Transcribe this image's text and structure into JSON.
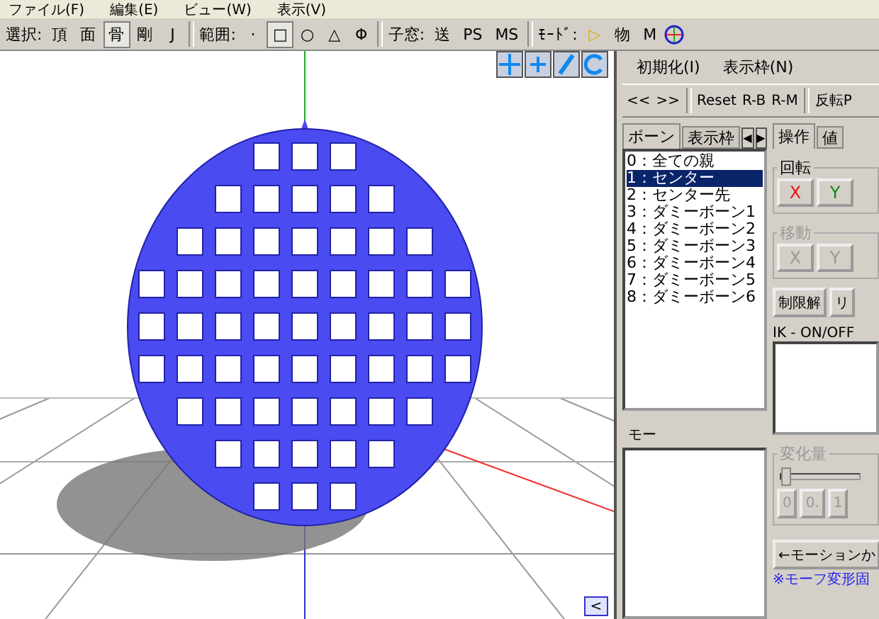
{
  "menu_bar": [
    "ファイル(F)",
    "編集(E)",
    "ビュー(W)",
    "表示(V)"
  ],
  "toolbar": [
    {
      "kind": "label",
      "text": "選択:"
    },
    {
      "kind": "button",
      "text": "頂",
      "selected": false
    },
    {
      "kind": "button",
      "text": "面",
      "selected": false
    },
    {
      "kind": "button",
      "text": "骨",
      "selected": true
    },
    {
      "kind": "button",
      "text": "剛",
      "selected": false
    },
    {
      "kind": "button",
      "text": "J",
      "selected": false
    },
    {
      "kind": "separator"
    },
    {
      "kind": "label",
      "text": "範囲:"
    },
    {
      "kind": "button",
      "text": "·",
      "selected": false
    },
    {
      "kind": "button",
      "text": "□",
      "selected": true
    },
    {
      "kind": "button",
      "text": "○",
      "selected": false
    },
    {
      "kind": "button",
      "text": "△",
      "selected": false
    },
    {
      "kind": "button",
      "text": "Φ",
      "selected": false
    },
    {
      "kind": "separator"
    },
    {
      "kind": "label",
      "text": "子窓:"
    },
    {
      "kind": "button",
      "text": "送",
      "selected": false
    },
    {
      "kind": "button",
      "text": "PS",
      "selected": false
    },
    {
      "kind": "button",
      "text": "MS",
      "selected": false
    },
    {
      "kind": "separator"
    },
    {
      "kind": "label",
      "text": "ﾓｰﾄﾞ:"
    },
    {
      "kind": "play",
      "text": "▷",
      "selected": false
    },
    {
      "kind": "button",
      "text": "物",
      "selected": false
    },
    {
      "kind": "button",
      "text": "M",
      "selected": false
    },
    {
      "kind": "gizmo"
    }
  ],
  "viewport": {
    "scroll_button": "<"
  },
  "panel": {
    "menu": [
      "初期化(I)",
      "表示枠(N)"
    ],
    "toolbar": [
      {
        "kind": "button",
        "text": "<<"
      },
      {
        "kind": "button",
        "text": ">>"
      },
      {
        "kind": "separator"
      },
      {
        "kind": "button",
        "text": "Reset"
      },
      {
        "kind": "button",
        "text": "R-B"
      },
      {
        "kind": "button",
        "text": "R-M"
      },
      {
        "kind": "separator"
      },
      {
        "kind": "button",
        "text": "反転P"
      }
    ],
    "list_tabs": [
      {
        "label": "ボーン",
        "selected": true
      },
      {
        "label": "表示枠",
        "selected": false
      }
    ],
    "tab_arrows": [
      "◀",
      "▶"
    ],
    "bones": [
      {
        "label": "0：全ての親",
        "selected": false
      },
      {
        "label": "1：センター",
        "selected": true
      },
      {
        "label": "2：センター先",
        "selected": false
      },
      {
        "label": "3：ダミーボーン1",
        "selected": false
      },
      {
        "label": "4：ダミーボーン2",
        "selected": false
      },
      {
        "label": "5：ダミーボーン3",
        "selected": false
      },
      {
        "label": "6：ダミーボーン4",
        "selected": false
      },
      {
        "label": "7：ダミーボーン5",
        "selected": false
      },
      {
        "label": "8：ダミーボーン6",
        "selected": false
      }
    ],
    "morph_label": "モー",
    "op_tabs": [
      {
        "label": "操作",
        "selected": true
      },
      {
        "label": "値",
        "selected": false
      }
    ],
    "rotate": {
      "title": "回転",
      "disabled": false,
      "buttons": [
        {
          "text": "X",
          "color": "#ee1111"
        },
        {
          "text": "Y",
          "color": "#118811"
        }
      ]
    },
    "move": {
      "title": "移動",
      "disabled": true,
      "buttons": [
        {
          "text": "X"
        },
        {
          "text": "Y"
        }
      ]
    },
    "limit_buttons": [
      "制限解",
      "リ"
    ],
    "ik_label": "IK - ON/OFF",
    "amount": {
      "title": "変化量",
      "disabled": true,
      "level": 0,
      "buttons": [
        "0",
        "0.",
        "1"
      ]
    },
    "from_motion_button": "←モーションか",
    "note": "※モーフ変形固"
  }
}
